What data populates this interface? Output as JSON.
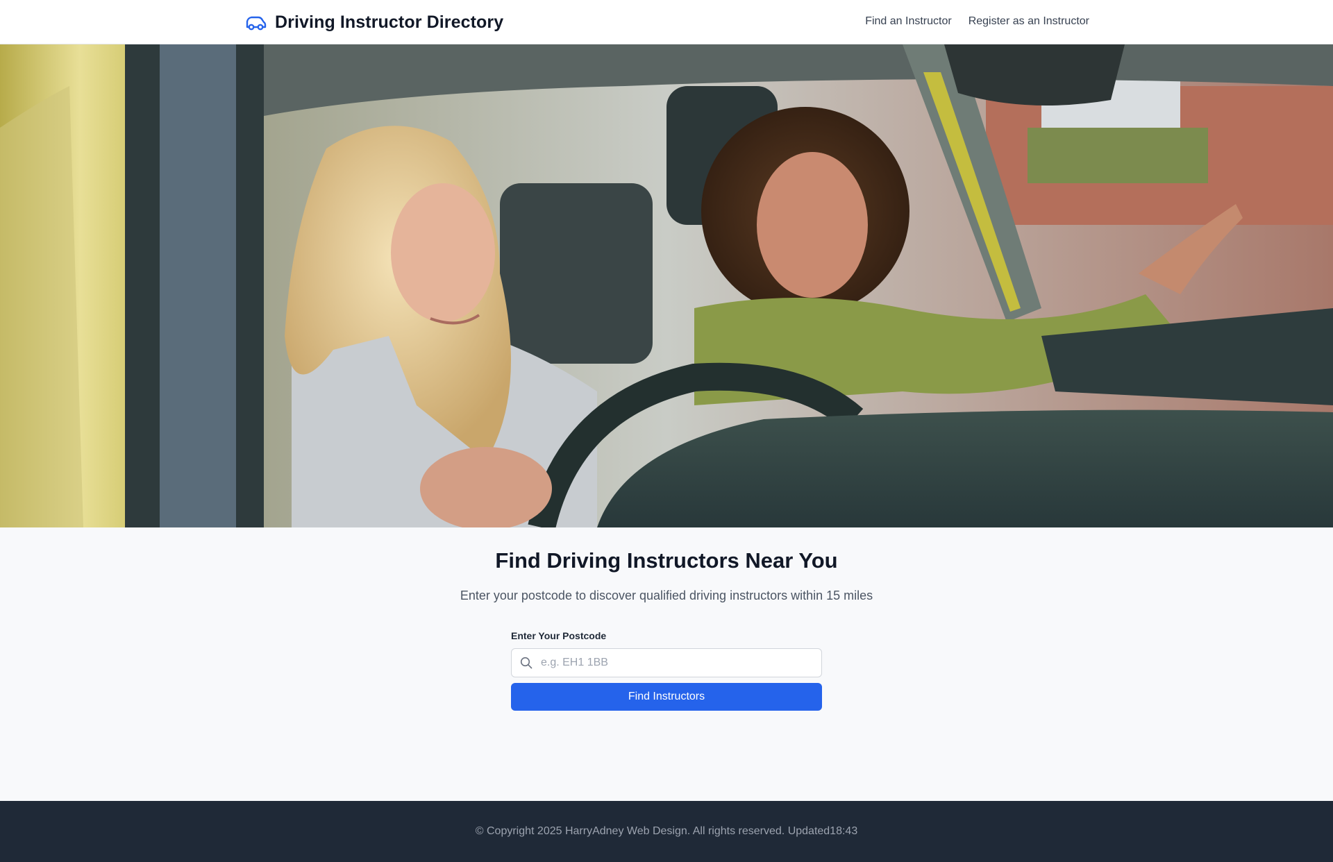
{
  "header": {
    "brand_title": "Driving Instructor Directory",
    "brand_icon": "car-icon",
    "nav": [
      {
        "label": "Find an Instructor"
      },
      {
        "label": "Register as an Instructor"
      }
    ]
  },
  "hero": {
    "image_alt": "Driving instructor and learner driver in a car"
  },
  "search": {
    "heading": "Find Driving Instructors Near You",
    "subheading": "Enter your postcode to discover qualified driving instructors within 15 miles",
    "label": "Enter Your Postcode",
    "placeholder": "e.g. EH1 1BB",
    "value": "",
    "icon": "search-icon",
    "button_label": "Find Instructors"
  },
  "footer": {
    "text": "© Copyright 2025 HarryAdney Web Design. All rights reserved. Updated18:43"
  },
  "colors": {
    "accent": "#2563eb",
    "footer_bg": "#1f2937",
    "page_bg": "#f8f9fb"
  }
}
